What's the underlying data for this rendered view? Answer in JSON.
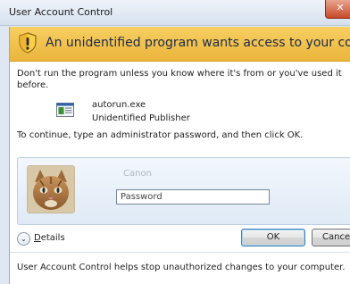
{
  "window": {
    "title": "User Account Control",
    "close_glyph": "✕"
  },
  "banner": {
    "text": "An unidentified program wants access to your computer",
    "icon": "shield-warning-icon"
  },
  "message": {
    "warning": "Don't run the program unless you know where it's from or you've used it before.",
    "program_name": "autorun.exe",
    "publisher": "Unidentified Publisher",
    "instruction": "To continue, type an administrator password, and then click OK."
  },
  "credentials": {
    "username": "Canon",
    "password_placeholder": "Password",
    "password_value": ""
  },
  "actions": {
    "details_prefix": "D",
    "details_rest": "etails",
    "ok_label": "OK",
    "cancel_label": "Cancel"
  },
  "footer": {
    "text": "User Account Control helps stop unauthorized changes to your computer."
  },
  "colors": {
    "banner": "#eab53b",
    "window_frame": "#dfe8f2",
    "close_button": "#c84a2a"
  }
}
